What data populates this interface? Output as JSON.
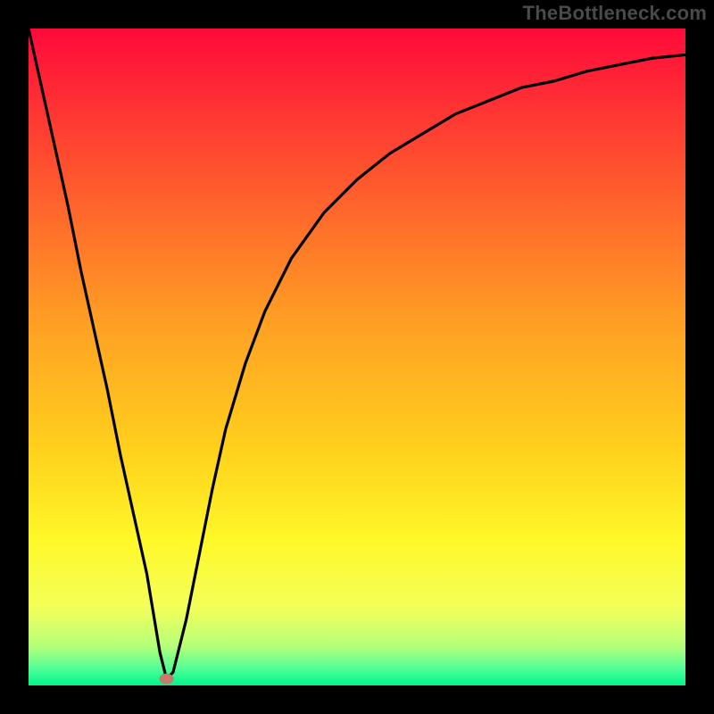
{
  "watermark": "TheBottleneck.com",
  "chart_data": {
    "type": "line",
    "title": "",
    "xlabel": "",
    "ylabel": "",
    "xlim": [
      0,
      100
    ],
    "ylim": [
      0,
      100
    ],
    "grid": false,
    "background": {
      "type": "gradient",
      "stops": [
        {
          "pos": 0.0,
          "color": "#ff0a3a"
        },
        {
          "pos": 0.2,
          "color": "#ff4d2f"
        },
        {
          "pos": 0.45,
          "color": "#ffa023"
        },
        {
          "pos": 0.65,
          "color": "#ffd31c"
        },
        {
          "pos": 0.78,
          "color": "#fff829"
        },
        {
          "pos": 0.88,
          "color": "#f4ff58"
        },
        {
          "pos": 0.94,
          "color": "#b6ff7a"
        },
        {
          "pos": 0.975,
          "color": "#4fff98"
        },
        {
          "pos": 1.0,
          "color": "#00f58a"
        }
      ]
    },
    "series": [
      {
        "name": "bottleneck-curve",
        "x": [
          0,
          2,
          4,
          6,
          8,
          10,
          12,
          14,
          16,
          18,
          20,
          21,
          22,
          24,
          26,
          28,
          30,
          33,
          36,
          40,
          45,
          50,
          55,
          60,
          65,
          70,
          75,
          80,
          85,
          90,
          95,
          100
        ],
        "values": [
          100,
          91,
          82,
          73,
          63,
          54,
          45,
          35,
          26,
          17,
          5,
          1,
          2,
          10,
          20,
          30,
          39,
          49,
          57,
          65,
          72,
          77,
          81,
          84,
          87,
          89,
          91,
          92,
          93.5,
          94.5,
          95.5,
          96
        ]
      }
    ],
    "marker": {
      "name": "optimal-point",
      "x": 21,
      "y": 1,
      "color": "#c97a6a"
    }
  }
}
